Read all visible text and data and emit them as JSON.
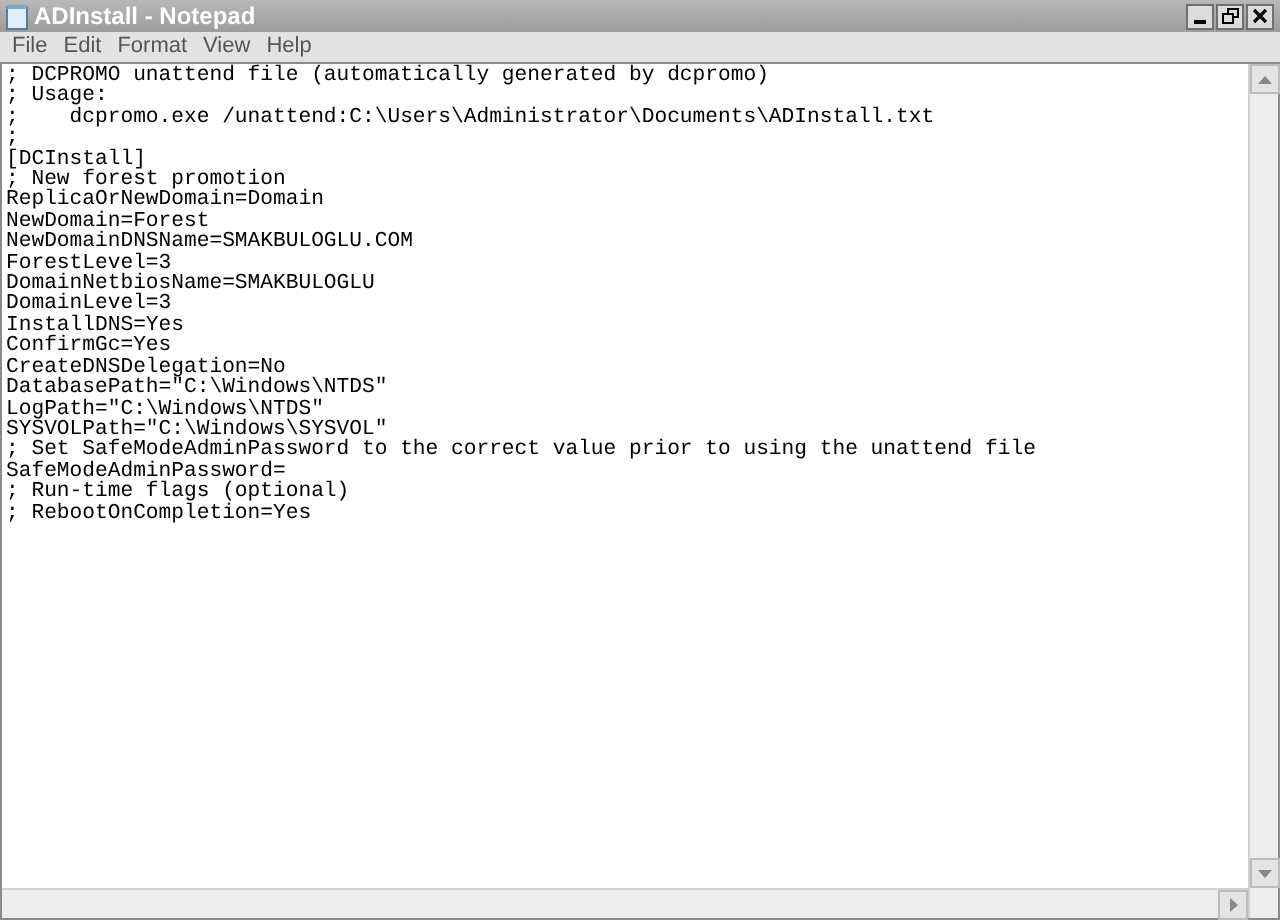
{
  "window": {
    "title": "ADInstall - Notepad"
  },
  "menu": [
    "File",
    "Edit",
    "Format",
    "View",
    "Help"
  ],
  "lines": [
    "; DCPROMO unattend file (automatically generated by dcpromo)",
    "; Usage:",
    ";    dcpromo.exe /unattend:C:\\Users\\Administrator\\Documents\\ADInstall.txt",
    ";",
    "[DCInstall]",
    "; New forest promotion",
    "ReplicaOrNewDomain=Domain",
    "NewDomain=Forest",
    "NewDomainDNSName=SMAKBULOGLU.COM",
    "ForestLevel=3",
    "DomainNetbiosName=SMAKBULOGLU",
    "DomainLevel=3",
    "InstallDNS=Yes",
    "ConfirmGc=Yes",
    "CreateDNSDelegation=No",
    "DatabasePath=\"C:\\Windows\\NTDS\"",
    "LogPath=\"C:\\Windows\\NTDS\"",
    "SYSVOLPath=\"C:\\Windows\\SYSVOL\"",
    "; Set SafeModeAdminPassword to the correct value prior to using the unattend file",
    "SafeModeAdminPassword=",
    "; Run-time flags (optional)",
    "; RebootOnCompletion=Yes"
  ]
}
